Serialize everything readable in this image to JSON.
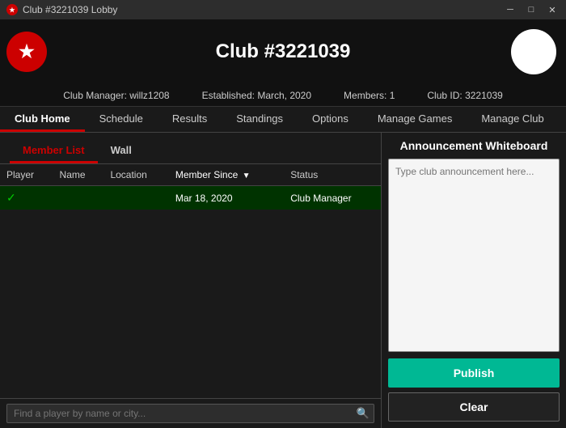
{
  "titleBar": {
    "title": "Club #3221039 Lobby",
    "minBtn": "─",
    "maxBtn": "□",
    "closeBtn": "✕"
  },
  "header": {
    "title": "Club #3221039",
    "logoStar": "★"
  },
  "infoBar": {
    "manager": "Club Manager: willz1208",
    "established": "Established: March, 2020",
    "members": "Members: 1",
    "clubId": "Club ID: 3221039"
  },
  "navTabs": [
    {
      "label": "Club Home",
      "id": "club-home",
      "active": true
    },
    {
      "label": "Schedule",
      "id": "schedule",
      "active": false
    },
    {
      "label": "Results",
      "id": "results",
      "active": false
    },
    {
      "label": "Standings",
      "id": "standings",
      "active": false
    },
    {
      "label": "Options",
      "id": "options",
      "active": false
    },
    {
      "label": "Manage Games",
      "id": "manage-games",
      "active": false
    },
    {
      "label": "Manage Club",
      "id": "manage-club",
      "active": false
    }
  ],
  "subTabs": [
    {
      "label": "Member List",
      "active": true
    },
    {
      "label": "Wall",
      "active": false
    }
  ],
  "table": {
    "columns": [
      {
        "label": "Player",
        "sorted": false
      },
      {
        "label": "Name",
        "sorted": false
      },
      {
        "label": "Location",
        "sorted": false
      },
      {
        "label": "Member Since",
        "sorted": true
      },
      {
        "label": "Status",
        "sorted": false
      }
    ],
    "rows": [
      {
        "check": "✓",
        "player": "",
        "name": "",
        "location": "",
        "memberSince": "Mar 18, 2020",
        "status": "Club Manager",
        "selected": true
      }
    ]
  },
  "search": {
    "placeholder": "Find a player by name or city...",
    "icon": "🔍"
  },
  "whiteboard": {
    "title": "Announcement Whiteboard",
    "placeholder": "Type club announcement here...",
    "publishLabel": "Publish",
    "clearLabel": "Clear"
  },
  "colors": {
    "accent": "#cc0000",
    "publishBg": "#00b894",
    "selectedRow": "#003300"
  }
}
